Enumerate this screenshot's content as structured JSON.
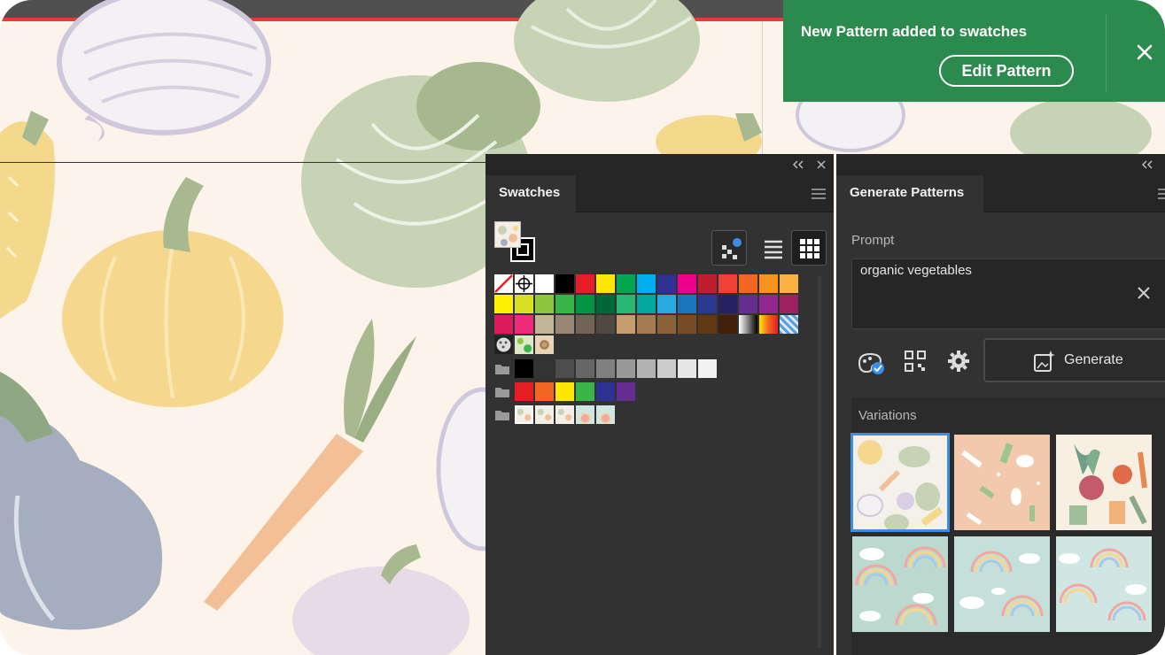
{
  "toast": {
    "message": "New Pattern added to swatches",
    "edit_label": "Edit Pattern",
    "close_icon": "close-icon"
  },
  "swatches_panel": {
    "tab_label": "Swatches",
    "collapse_icon": "double-chevron-left-icon",
    "close_icon": "close-icon",
    "menu_icon": "hamburger-menu-icon",
    "view_modes": [
      "swatch-kinds-icon",
      "list-view-icon",
      "grid-view-icon"
    ],
    "active_view": "grid-view-icon",
    "color_rows": [
      [
        "none",
        "registration",
        "#ffffff",
        "#000000",
        "#e31e24",
        "#ffe600",
        "#00a650",
        "#00aeef",
        "#2e3192",
        "#ec008c",
        "#be1e2d",
        "#ef4136",
        "#f26522",
        "#f7941d",
        "#fbb040"
      ],
      [
        "#fff200",
        "#d7e021",
        "#8dc63f",
        "#39b54a",
        "#009444",
        "#006838",
        "#2bb673",
        "#00a79d",
        "#27aae1",
        "#1c75bc",
        "#2b3990",
        "#262262",
        "#662d91",
        "#92278f",
        "#9e1f63"
      ],
      [
        "#da1c5c",
        "#ee2a7b",
        "#c2b59b",
        "#998675",
        "#736357",
        "#534741",
        "#c69c6d",
        "#a67c52",
        "#8c6239",
        "#754c24",
        "#603913",
        "#42210b",
        "gradient-bw",
        "gradient-orange",
        "gradient-blue"
      ],
      [
        "pattern-dots",
        "pattern-leaves",
        "pattern-floral"
      ]
    ],
    "group_rows": [
      [
        "#000000",
        "#333333",
        "#4d4d4d",
        "#666666",
        "#808080",
        "#999999",
        "#b3b3b3",
        "#cccccc",
        "#e6e6e6",
        "#f2f2f2"
      ],
      [
        "#e31e24",
        "#f26522",
        "#ffe600",
        "#39b54a",
        "#2e3192",
        "#662d91"
      ],
      [
        "pattern-vegetables",
        "pattern-vegetables-2",
        "pattern-vegetables-3",
        "pattern-rainbow",
        "pattern-rainbow-2"
      ]
    ],
    "folder_icon": "folder-icon"
  },
  "generate_panel": {
    "tab_label": "Generate Patterns",
    "collapse_icon": "double-chevron-left-icon",
    "prompt_label": "Prompt",
    "prompt_value": "organic vegetables",
    "clear_icon": "close-icon",
    "tool_icons": [
      "style-reference-icon",
      "tile-type-icon",
      "settings-icon"
    ],
    "generate_label": "Generate",
    "generate_icon": "sparkle-image-icon",
    "variations_label": "Variations",
    "variations": [
      {
        "kind": "vegetables-cream",
        "selected": true
      },
      {
        "kind": "vegetables-peach",
        "selected": false
      },
      {
        "kind": "vegetables-beet",
        "selected": false
      },
      {
        "kind": "rainbow-clouds",
        "selected": false
      },
      {
        "kind": "rainbow-clouds-2",
        "selected": false
      },
      {
        "kind": "rainbow-clouds-3",
        "selected": false
      }
    ]
  },
  "colors": {
    "toast_green": "#2b8a4e",
    "panel_bg": "#323232",
    "selection_blue": "#3a8ee6",
    "canvas_bg": "#fcf4ea"
  }
}
